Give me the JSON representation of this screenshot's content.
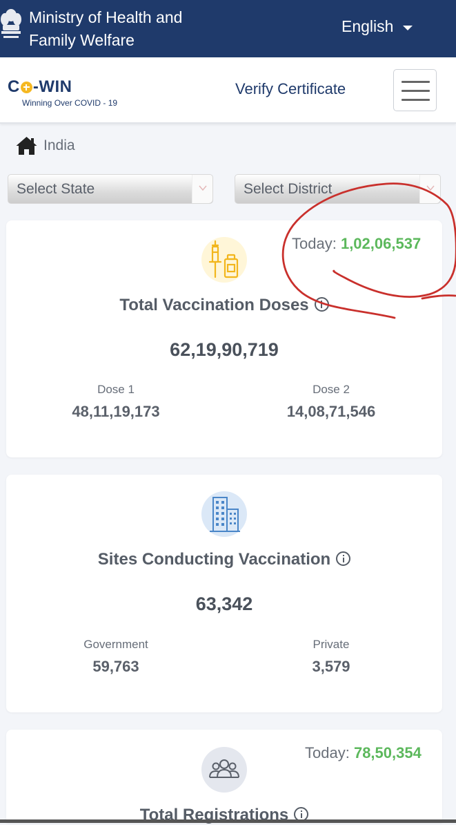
{
  "ministry": {
    "title_line1": "Ministry of Health and",
    "title_line2": "Family Welfare",
    "language": "English"
  },
  "nav": {
    "logo_left": "C",
    "logo_right": "-WIN",
    "tagline": "Winning Over COVID - 19",
    "verify_label": "Verify Certificate"
  },
  "breadcrumb": {
    "label": "India"
  },
  "filters": {
    "state_label": "Select State",
    "district_label": "Select District"
  },
  "cards": [
    {
      "title": "Total Vaccination Doses",
      "total": "62,19,90,719",
      "today_label": "Today:",
      "today_value": "1,02,06,537",
      "left_label": "Dose 1",
      "left_value": "48,11,19,173",
      "right_label": "Dose 2",
      "right_value": "14,08,71,546"
    },
    {
      "title": "Sites Conducting Vaccination",
      "total": "63,342",
      "left_label": "Government",
      "left_value": "59,763",
      "right_label": "Private",
      "right_value": "3,579"
    },
    {
      "title": "Total Registrations",
      "today_label": "Today:",
      "today_value": "78,50,354"
    }
  ],
  "colors": {
    "header": "#1f3a6b",
    "accent_green": "#5cb85c",
    "annotation_red": "#c9302c",
    "logo_yellow": "#f5b822"
  },
  "icons": [
    "emblem-icon",
    "caret-down-icon",
    "home-icon",
    "chevron-down-icon",
    "vaccine-syringe-icon",
    "building-icon",
    "people-group-icon",
    "info-icon"
  ]
}
